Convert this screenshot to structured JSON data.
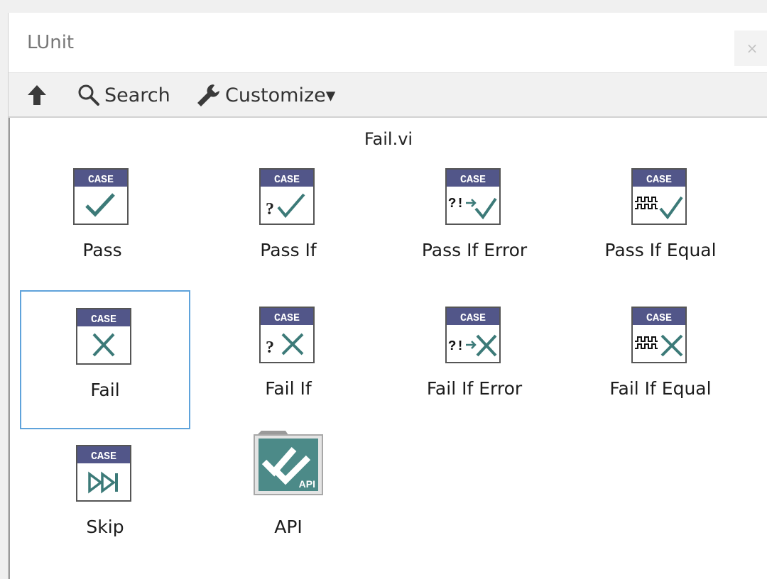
{
  "window": {
    "title": "LUnit",
    "close_glyph": "×"
  },
  "toolbar": {
    "up_icon": "up-arrow-icon",
    "search": {
      "label": "Search",
      "icon": "magnifier-icon"
    },
    "customize": {
      "label": "Customize▾",
      "icon": "wrench-icon"
    }
  },
  "palette": {
    "subtitle": "Fail.vi",
    "items": [
      {
        "label": "Pass",
        "badge": "CASE",
        "icon": "check-icon"
      },
      {
        "label": "Pass If",
        "badge": "CASE",
        "icon": "question-check-icon",
        "prefix": "?"
      },
      {
        "label": "Pass If Error",
        "badge": "CASE",
        "icon": "error-arrow-check-icon",
        "prefix": "?!"
      },
      {
        "label": "Pass If Equal",
        "badge": "CASE",
        "icon": "waveform-check-icon"
      },
      {
        "label": "Fail",
        "badge": "CASE",
        "icon": "x-mark-icon",
        "selected": true
      },
      {
        "label": "Fail If",
        "badge": "CASE",
        "icon": "question-x-icon",
        "prefix": "?"
      },
      {
        "label": "Fail If Error",
        "badge": "CASE",
        "icon": "error-arrow-x-icon",
        "prefix": "?!"
      },
      {
        "label": "Fail If Equal",
        "badge": "CASE",
        "icon": "waveform-x-icon"
      },
      {
        "label": "Skip",
        "badge": "CASE",
        "icon": "skip-forward-icon"
      },
      {
        "label": "API",
        "badge": "API",
        "icon": "api-folder-icon"
      }
    ]
  },
  "colors": {
    "case_header": "#525689",
    "check_teal": "#3c7a78",
    "api_folder": "#4c8a88",
    "selection_border": "#5fa3db"
  }
}
